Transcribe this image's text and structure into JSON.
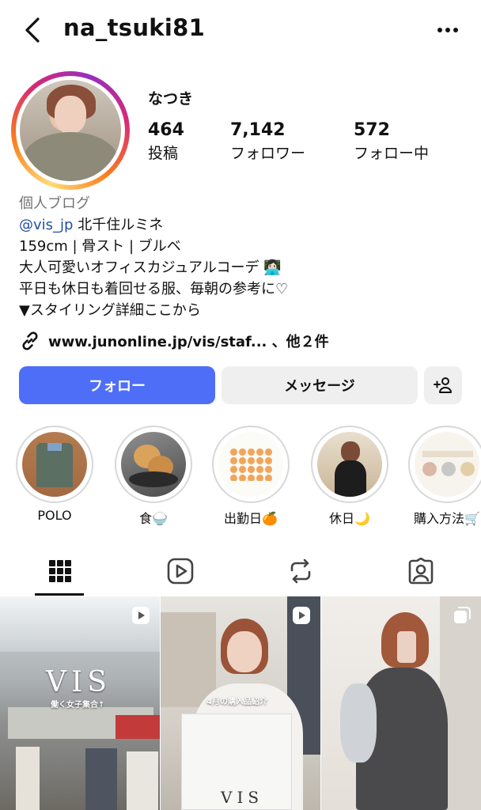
{
  "header": {
    "username": "na_tsuki81"
  },
  "profile": {
    "display_name": "なつき",
    "stats": [
      {
        "value": "464",
        "label": "投稿"
      },
      {
        "value": "7,142",
        "label": "フォロワー"
      },
      {
        "value": "572",
        "label": "フォロー中"
      }
    ],
    "category": "個人ブログ",
    "mention": "@vis_jp",
    "bio_line1_rest": " 北千住ルミネ",
    "bio_line2": "159cm | 骨スト | ブルベ",
    "bio_line3": "大人可愛いオフィスカジュアルコーデ 👩🏻‍💻",
    "bio_line4": "平日も休日も着回せる服、毎朝の参考に♡",
    "bio_line5": "▼スタイリング詳細ここから",
    "link_text": "www.junonline.jp/vis/staf... 、他２件"
  },
  "actions": {
    "follow": "フォロー",
    "message": "メッセージ",
    "add_user_icon": "person-add-icon"
  },
  "highlights": [
    {
      "label": "POLO"
    },
    {
      "label": "食🍚"
    },
    {
      "label": "出勤日🍊"
    },
    {
      "label": "休日🌙"
    },
    {
      "label": "購入方法🛒"
    }
  ],
  "tabs": [
    {
      "icon": "grid-icon",
      "active": true
    },
    {
      "icon": "reels-icon",
      "active": false
    },
    {
      "icon": "reposts-icon",
      "active": false
    },
    {
      "icon": "tagged-icon",
      "active": false
    }
  ],
  "posts": [
    {
      "overlay_title": "VIS",
      "overlay_text": "働く女子集合↑",
      "badge": "reel-icon"
    },
    {
      "overlay_title": "VIS",
      "overlay_text": "4月の購入品紹介",
      "badge": "reel-icon"
    },
    {
      "overlay_text": "",
      "badge": "carousel-icon"
    }
  ],
  "colors": {
    "follow_button": "#4f6ef7",
    "secondary_button": "#efefef",
    "mention": "#1f4fa6"
  }
}
